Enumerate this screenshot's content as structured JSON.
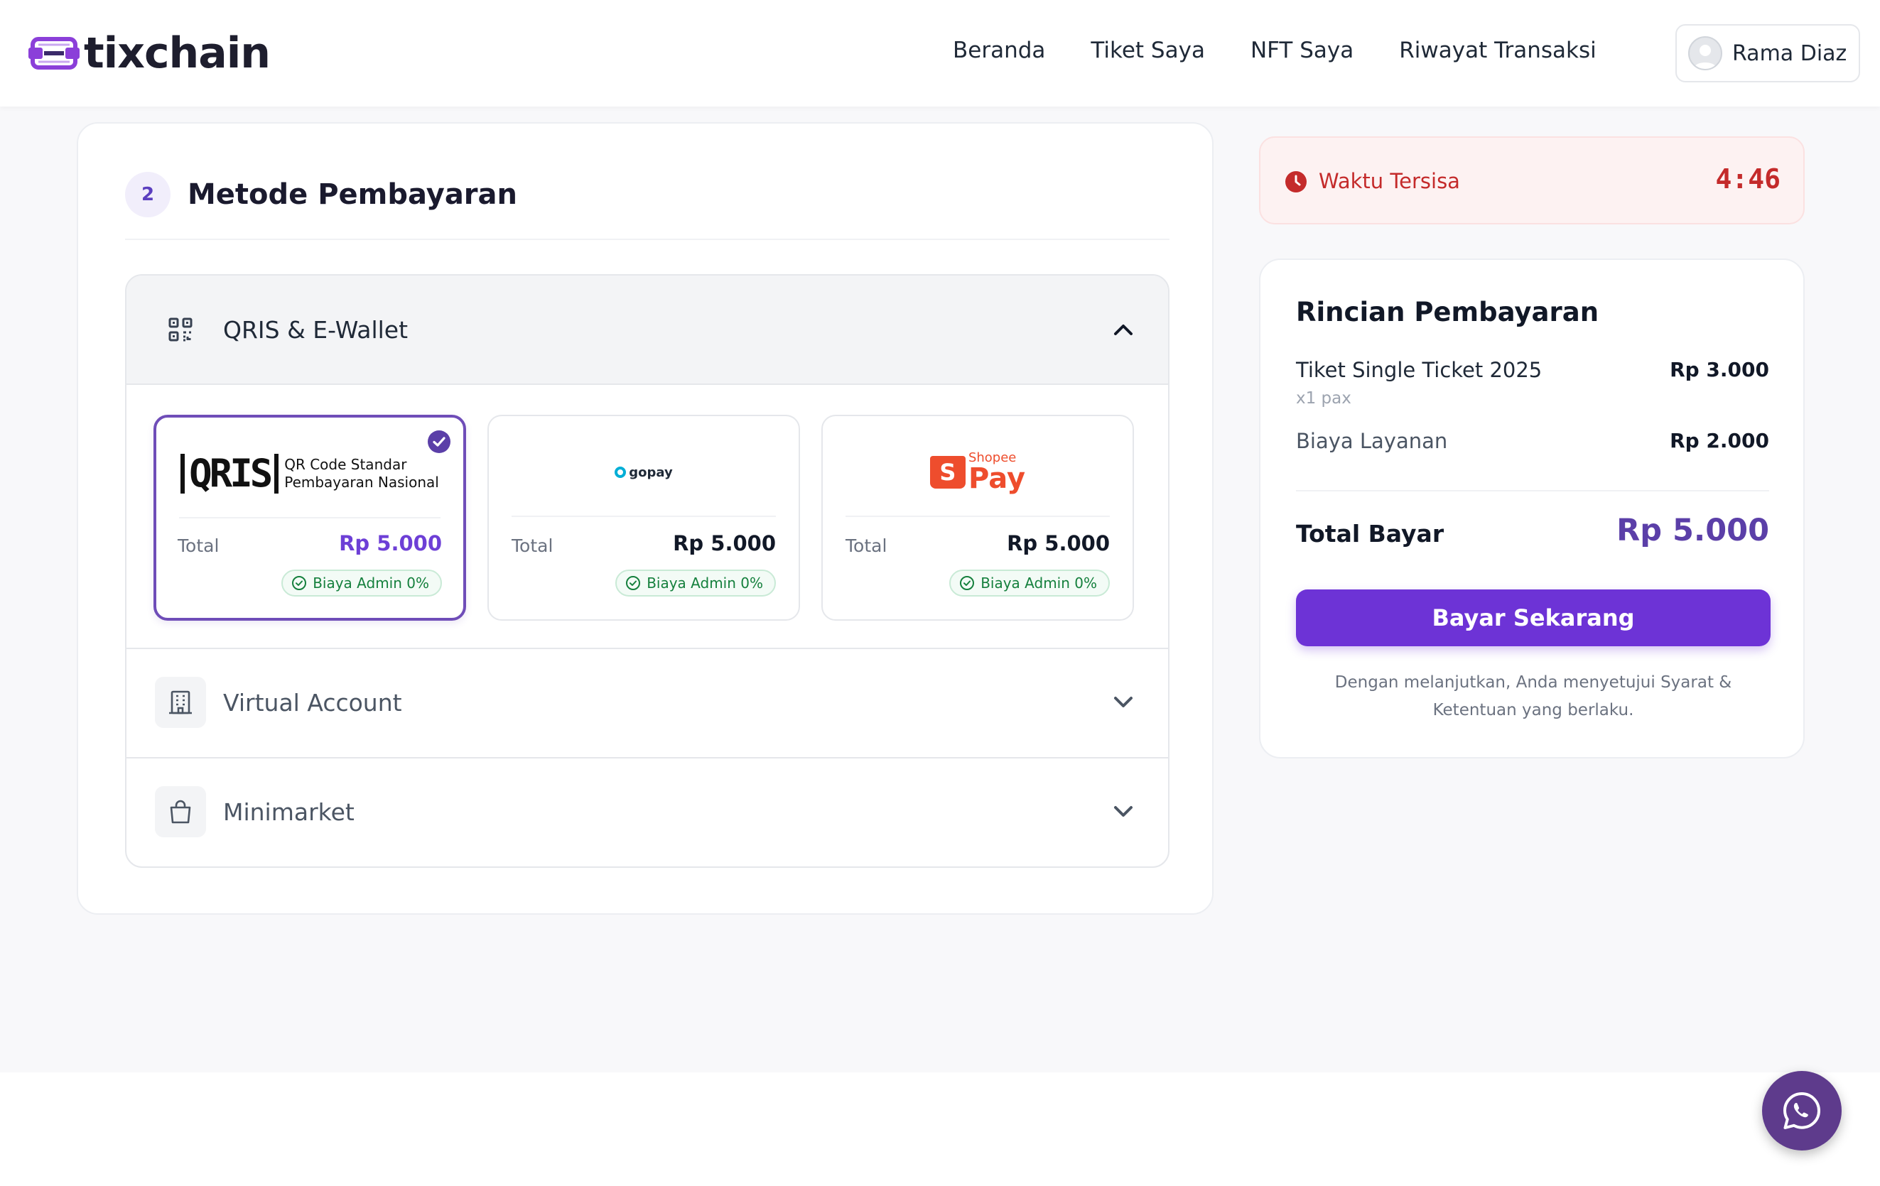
{
  "header": {
    "logo_text": "tixchain",
    "nav": [
      "Beranda",
      "Tiket Saya",
      "NFT Saya",
      "Riwayat Transaksi"
    ],
    "user_name": "Rama Diaz"
  },
  "payment": {
    "step_number": "2",
    "title": "Metode Pembayaran",
    "groups": {
      "qris_ewallet": "QRIS & E-Wallet",
      "virtual_account": "Virtual Account",
      "minimarket": "Minimarket"
    },
    "methods": [
      {
        "name": "QRIS",
        "logo_word": "QRIS",
        "logo_sub_line1": "QR Code Standar",
        "logo_sub_line2": "Pembayaran Nasional",
        "total_label": "Total",
        "total": "Rp 5.000",
        "admin": "Biaya Admin 0%",
        "selected": true
      },
      {
        "name": "gopay",
        "logo_word": "gopay",
        "total_label": "Total",
        "total": "Rp 5.000",
        "admin": "Biaya Admin 0%",
        "selected": false
      },
      {
        "name": "ShopeePay",
        "logo_bag_letter": "S",
        "logo_top": "Shopee",
        "logo_word": "Pay",
        "total_label": "Total",
        "total": "Rp 5.000",
        "admin": "Biaya Admin 0%",
        "selected": false
      }
    ]
  },
  "timer": {
    "label": "Waktu Tersisa",
    "value": "4:46"
  },
  "summary": {
    "title": "Rincian Pembayaran",
    "ticket_label": "Tiket Single Ticket 2025",
    "ticket_value": "Rp 3.000",
    "ticket_sub": "x1 pax",
    "service_label": "Biaya Layanan",
    "service_value": "Rp 2.000",
    "total_label": "Total Bayar",
    "total_value": "Rp 5.000",
    "pay_button": "Bayar Sekarang",
    "terms_line1": "Dengan melanjutkan, Anda menyetujui Syarat &",
    "terms_line2": "Ketentuan yang berlaku."
  },
  "colors": {
    "accent": "#6d33d6",
    "brand_purple": "#5b3fa8",
    "timer_red": "#c42b2b",
    "success_green": "#15803d"
  },
  "icons": {
    "logo": "tixchain-logo-icon",
    "qris_group": "qr-code-icon",
    "virtual_account": "building-icon",
    "minimarket": "shopping-bag-icon",
    "timer": "clock-icon",
    "whatsapp": "whatsapp-icon"
  }
}
